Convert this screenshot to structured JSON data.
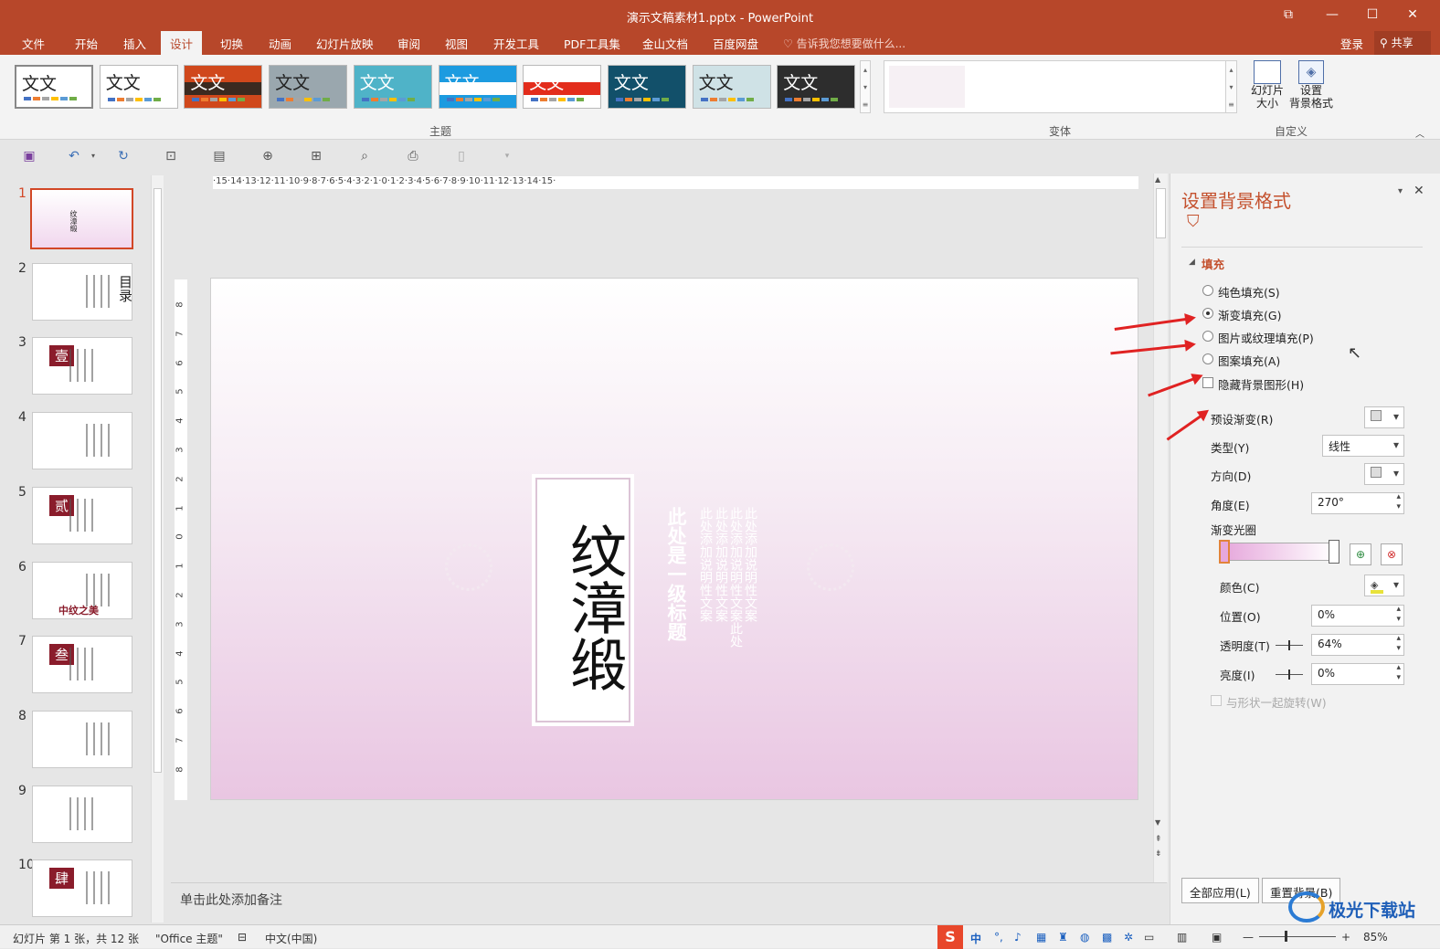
{
  "window": {
    "title": "演示文稿素材1.pptx - PowerPoint",
    "buttons": [
      "⧉",
      "—",
      "☐",
      "✕"
    ]
  },
  "tabs": [
    "文件",
    "开始",
    "插入",
    "设计",
    "切换",
    "动画",
    "幻灯片放映",
    "审阅",
    "视图",
    "开发工具",
    "PDF工具集",
    "金山文档",
    "百度网盘"
  ],
  "active_tab": "设计",
  "tell_me": "告诉我您想要做什么...",
  "account": {
    "login": "登录",
    "share": "共享"
  },
  "ribbon": {
    "theme_label": "文文",
    "groups": {
      "themes": "主题",
      "variants": "变体",
      "customize": "自定义"
    },
    "slide_size": "幻灯片\n大小",
    "format_background": "设置\n背景格式",
    "themes": [
      {
        "bg": "#ffffff",
        "fg": "#222",
        "band": ""
      },
      {
        "bg": "#ffffff",
        "fg": "#222",
        "band": ""
      },
      {
        "bg": "#d0481c",
        "fg": "#fff",
        "band": "#3b2a20"
      },
      {
        "bg": "#9aa7ae",
        "fg": "#222",
        "band": ""
      },
      {
        "bg": "#4fb3c8",
        "fg": "#fff",
        "band": ""
      },
      {
        "bg": "#1c9be0",
        "fg": "#fff",
        "band": "#ffffff"
      },
      {
        "bg": "#ffffff",
        "fg": "#fff",
        "band": "#e32d1c"
      },
      {
        "bg": "#12506a",
        "fg": "#fff",
        "band": ""
      },
      {
        "bg": "#cfe2e6",
        "fg": "#222",
        "band": ""
      },
      {
        "bg": "#2d2d2d",
        "fg": "#fff",
        "band": ""
      }
    ]
  },
  "slides": [
    {
      "n": "1",
      "text": "纹漳缎"
    },
    {
      "n": "2",
      "text": "目录"
    },
    {
      "n": "3",
      "text": "壹"
    },
    {
      "n": "4",
      "text": ""
    },
    {
      "n": "5",
      "text": "贰"
    },
    {
      "n": "6",
      "text": "中纹之美"
    },
    {
      "n": "7",
      "text": "叁"
    },
    {
      "n": "8",
      "text": ""
    },
    {
      "n": "9",
      "text": ""
    },
    {
      "n": "10",
      "text": "肆"
    }
  ],
  "slide": {
    "title": "纹漳缎",
    "heading": "此处是一级标题",
    "body_lines": [
      "此处添加说明性文案",
      "此处添加说明性文案",
      "此处添加说明性文案此处",
      "此处添加说明性文案"
    ]
  },
  "notes": "单击此处添加备注",
  "ruler_h": "·15·14·13·12·11·10·9·8·7·6·5·4·3·2·1·0·1·2·3·4·5·6·7·8·9·10·11·12·13·14·15·",
  "ruler_v": [
    "8",
    "7",
    "6",
    "5",
    "4",
    "3",
    "2",
    "1",
    "0",
    "1",
    "2",
    "3",
    "4",
    "5",
    "6",
    "7",
    "8"
  ],
  "pane": {
    "title": "设置背景格式",
    "section": "填充",
    "options": [
      "纯色填充(S)",
      "渐变填充(G)",
      "图片或纹理填充(P)",
      "图案填充(A)"
    ],
    "selected_option": "渐变填充(G)",
    "hide_bg": "隐藏背景图形(H)",
    "preset": "预设渐变(R)",
    "type_label": "类型(Y)",
    "type_value": "线性",
    "direction": "方向(D)",
    "angle_label": "角度(E)",
    "angle_value": "270°",
    "stops": "渐变光圈",
    "color": "颜色(C)",
    "position_label": "位置(O)",
    "position_value": "0%",
    "transparency_label": "透明度(T)",
    "transparency_value": "64%",
    "brightness_label": "亮度(I)",
    "brightness_value": "0%",
    "rotate": "与形状一起旋转(W)",
    "apply_all": "全部应用(L)",
    "reset": "重置背景(B)"
  },
  "status": {
    "slide": "幻灯片 第 1 张，共 12 张",
    "theme": "\"Office 主题\"",
    "lang": "中文(中国)",
    "zoom": "85%",
    "ime": "中"
  },
  "watermark": "极光下载站",
  "colors": {
    "accent": "#b7472a",
    "pane_title": "#c4512e",
    "arrow": "#e02222"
  }
}
